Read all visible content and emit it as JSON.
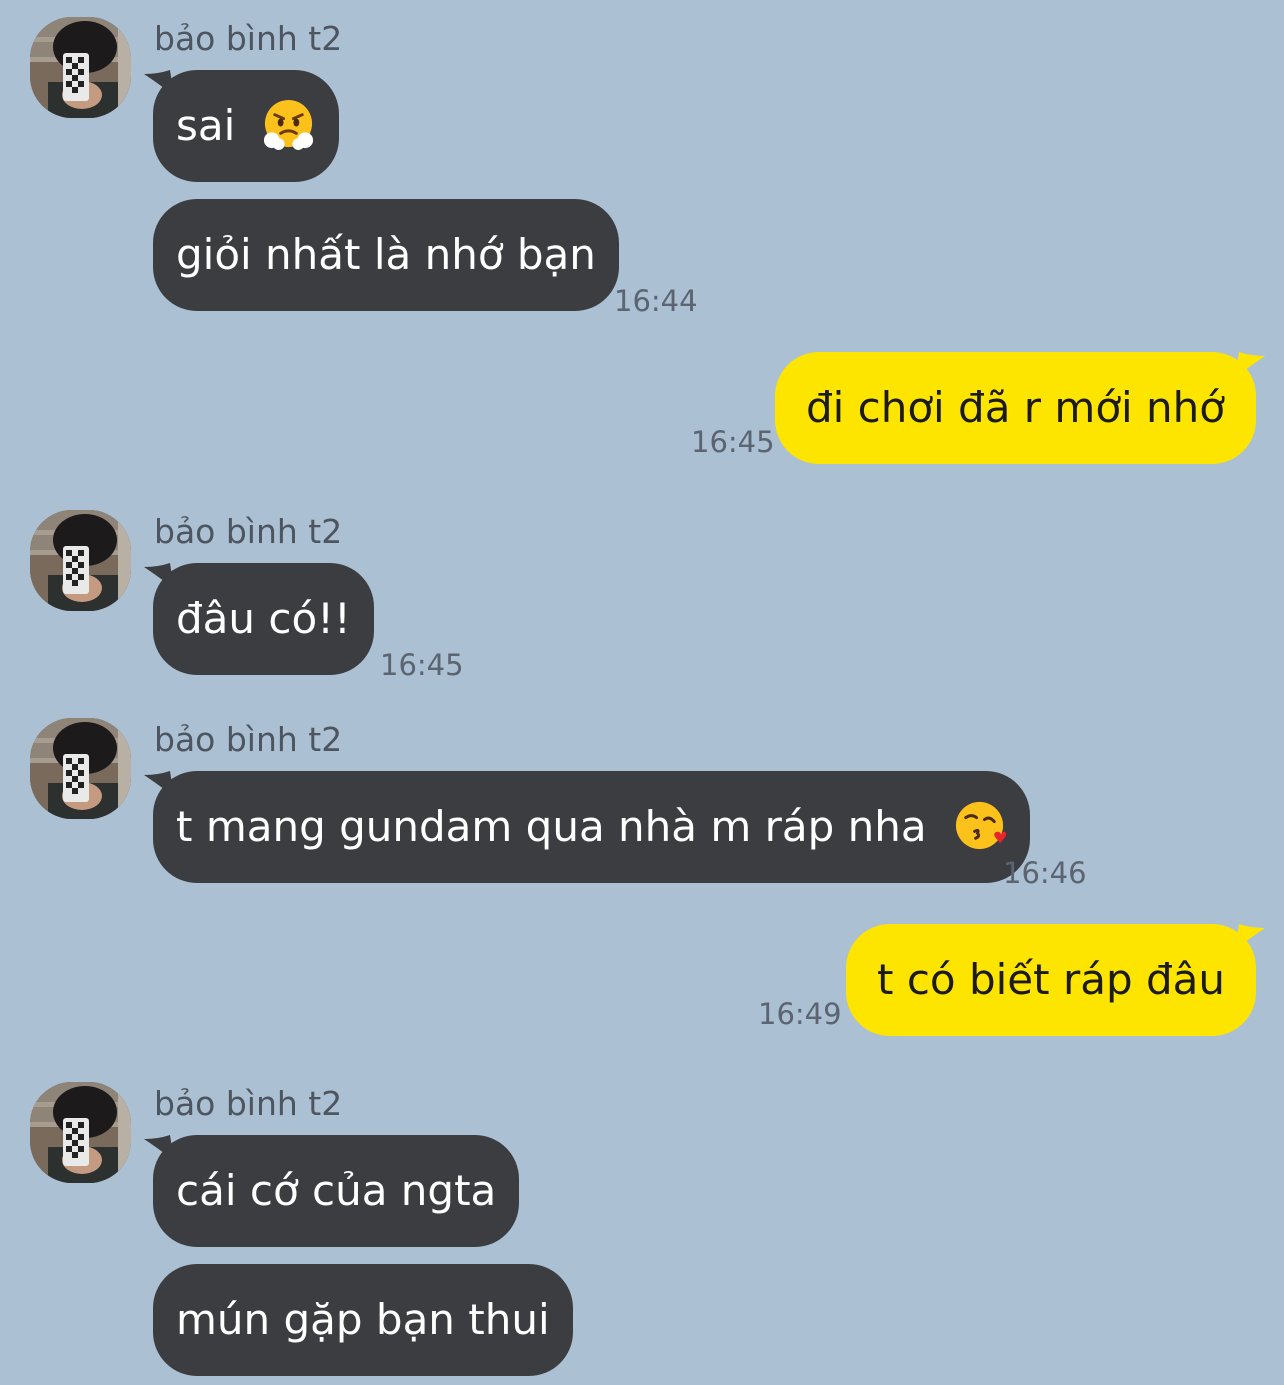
{
  "chat": {
    "contact_name": "bảo bình t2",
    "avatar_icon": "profile-photo",
    "colors": {
      "background": "#abc1d3",
      "incoming_bubble": "#3c3d41",
      "outgoing_bubble": "#fee500"
    },
    "messages": [
      {
        "sender": "bảo bình t2",
        "direction": "incoming",
        "text": "sai",
        "emoji": "face-with-steam-from-nose"
      },
      {
        "direction": "incoming",
        "text": "giỏi nhất là nhớ bạn",
        "time": "16:44"
      },
      {
        "direction": "outgoing",
        "text": "đi chơi đã r mới nhớ",
        "time": "16:45"
      },
      {
        "sender": "bảo bình t2",
        "direction": "incoming",
        "text": "đâu có!!",
        "time": "16:45"
      },
      {
        "sender": "bảo bình t2",
        "direction": "incoming",
        "text": "t mang gundam qua nhà m ráp nha",
        "emoji": "face-blowing-a-kiss",
        "time": "16:46"
      },
      {
        "direction": "outgoing",
        "text": "t có biết ráp đâu",
        "time": "16:49"
      },
      {
        "sender": "bảo bình t2",
        "direction": "incoming",
        "text": "cái cớ của ngta"
      },
      {
        "direction": "incoming",
        "text": "mún gặp bạn thui"
      }
    ]
  }
}
